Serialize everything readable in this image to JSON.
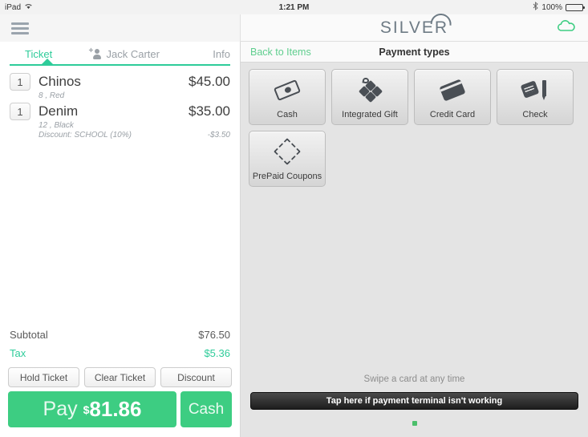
{
  "statusbar": {
    "device": "iPad",
    "wifi_icon": "wifi-icon",
    "time": "1:21 PM",
    "bluetooth_icon": "bluetooth-icon",
    "battery_percent": "100%",
    "battery_icon": "battery-full-icon"
  },
  "topbar": {
    "menu_icon": "hamburger-menu-icon",
    "logo_text": "SILVER",
    "cloud_icon": "cloud-icon",
    "cloud_color": "#3dcd82"
  },
  "tabs": [
    {
      "label": "Ticket",
      "icon": "list-icon",
      "active": true
    },
    {
      "label": "Jack Carter",
      "icon": "person-add-icon",
      "active": false
    },
    {
      "label": "Info",
      "icon": "document-add-icon",
      "active": false
    }
  ],
  "ticket": {
    "items": [
      {
        "qty": "1",
        "name": "Chinos",
        "price": "$45.00",
        "options": "8 , Red",
        "discount_label": "",
        "discount_amount": ""
      },
      {
        "qty": "1",
        "name": "Denim",
        "price": "$35.00",
        "options": "12 , Black",
        "discount_label": "Discount: SCHOOL (10%)",
        "discount_amount": "-$3.50"
      }
    ],
    "subtotal_label": "Subtotal",
    "subtotal_value": "$76.50",
    "tax_label": "Tax",
    "tax_value": "$5.36",
    "actions": [
      {
        "label": "Hold Ticket"
      },
      {
        "label": "Clear Ticket"
      },
      {
        "label": "Discount"
      }
    ],
    "pay_word": "Pay",
    "pay_currency": "$",
    "pay_amount": "81.86",
    "cash_label": "Cash",
    "accent_green": "#3dcd82",
    "tax_green": "#2ecc9a"
  },
  "payment": {
    "back_label": "Back to Items",
    "title": "Payment types",
    "tiles": [
      {
        "label": "Cash",
        "icon": "cash-icon"
      },
      {
        "label": "Integrated Gift",
        "icon": "gift-icon"
      },
      {
        "label": "Credit Card",
        "icon": "credit-card-icon"
      },
      {
        "label": "Check",
        "icon": "check-pen-icon"
      },
      {
        "label": "PrePaid Coupons",
        "icon": "coupon-diamond-icon"
      }
    ],
    "swipe_text": "Swipe a card at any time",
    "terminal_button": "Tap here if payment terminal isn't working",
    "page_indicator_color": "#4bbf6b"
  }
}
